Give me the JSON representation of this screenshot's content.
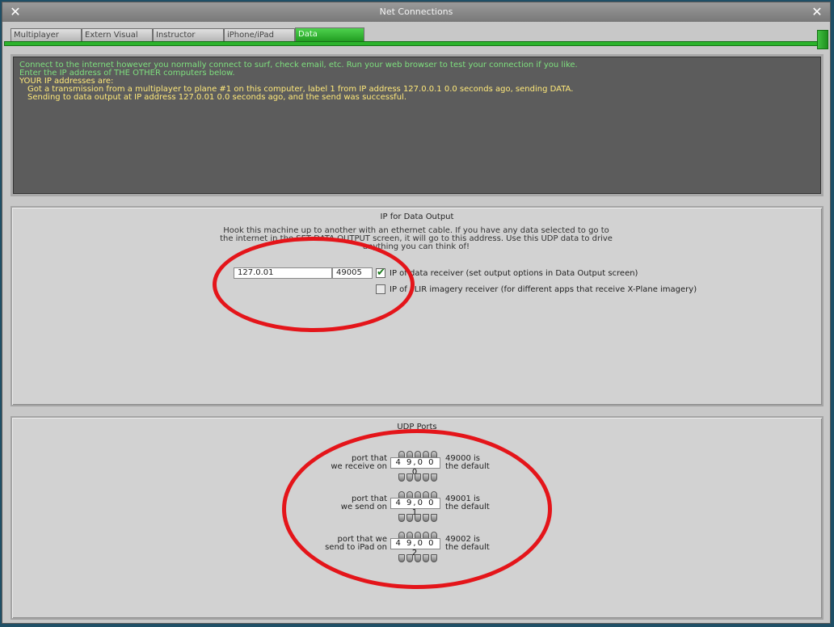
{
  "window": {
    "title": "Net Connections"
  },
  "tabs": [
    {
      "label": "Multiplayer"
    },
    {
      "label": "Extern Visual"
    },
    {
      "label": "Instructor"
    },
    {
      "label": "iPhone/iPad"
    },
    {
      "label": "Data"
    }
  ],
  "console": {
    "lines": [
      "Connect to the internet however you normally connect to surf, check email, etc. Run your web browser to test your connection if you like.",
      "Enter the IP address of THE OTHER computers below.",
      "YOUR IP addresses are:",
      "Got a transmission from a multiplayer to plane #1 on this computer, label 1 from IP address 127.0.0.1  0.0 seconds ago, sending DATA.",
      "Sending to  data output at IP address 127.0.01  0.0 seconds ago,  and the send was successful."
    ]
  },
  "ip_panel": {
    "title": "IP for Data Output",
    "description_lines": [
      "Hook this machine up to another with an ethernet cable. If you have any data selected to go to",
      "the internet in the SET DATA OUTPUT screen, it will go to this address. Use this UDP data to drive",
      "anything you can think of!"
    ],
    "ip_value": "127.0.01",
    "port_value": "49005",
    "option1_label": "IP of data receiver (set output options in Data Output screen)",
    "option1_checked": true,
    "option2_label": "IP of FLIR imagery receiver (for different apps that receive X-Plane imagery)",
    "option2_checked": false
  },
  "udp_panel": {
    "title": "UDP Ports",
    "ports": [
      {
        "label_line1": "port that",
        "label_line2": "we receive on",
        "value": "4 9,0 0 0",
        "default_line1": "49000 is",
        "default_line2": "the default"
      },
      {
        "label_line1": "port that",
        "label_line2": "we send on",
        "value": "4 9,0 0 1",
        "default_line1": "49001 is",
        "default_line2": "the default"
      },
      {
        "label_line1": "port that we",
        "label_line2": "send to iPad on",
        "value": "4 9,0 0 2",
        "default_line1": "49002 is",
        "default_line2": "the default"
      }
    ]
  },
  "colors": {
    "accent": "#2cb32c",
    "annotation": "#e4151a"
  }
}
